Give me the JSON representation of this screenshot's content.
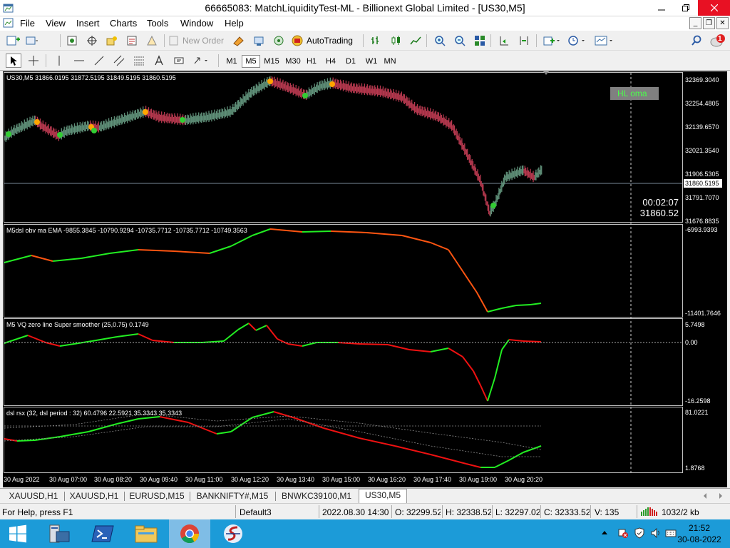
{
  "window": {
    "title": "66665083: MatchLiquidityTest-ML - Billionext Global Limited - [US30,M5]"
  },
  "menu": {
    "items": [
      "File",
      "View",
      "Insert",
      "Charts",
      "Tools",
      "Window",
      "Help"
    ]
  },
  "toolbar": {
    "new_order_label": "New Order",
    "autotrading_label": "AutoTrading",
    "alert_count": "1"
  },
  "timeframes": [
    "M1",
    "M5",
    "M15",
    "M30",
    "H1",
    "H4",
    "D1",
    "W1",
    "MN"
  ],
  "active_timeframe": "M5",
  "chart": {
    "main_header": "US30,M5  31866.0195 31872.5195 31849.5195 31860.5195",
    "hl_label": "HL oma",
    "countdown": "00:02:07",
    "bid_label": "31860.52",
    "price_box": "31860.5195",
    "price_ticks": [
      "32369.3040",
      "32254.4805",
      "32139.6570",
      "32021.3540",
      "31906.5305",
      "31791.7070",
      "31676.8835"
    ],
    "ind1_header": "M5dsl  obv ma  EMA  -9855.3845 -10790.9294 -10735.7712 -10735.7712 -10749.3563",
    "ind1_ticks": [
      "-6993.9393",
      "-11401.7646"
    ],
    "ind2_header": "M5 VQ zero line Super smoother (25,0.75) 0.1749",
    "ind2_ticks": [
      "5.7498",
      "0.00",
      "-16.2598"
    ],
    "ind3_header": "dsl rsx (32, dsl period : 32) 60.4796 22.5921 35.3343 35.3343",
    "ind3_ticks": [
      "81.0221",
      "1.8768"
    ],
    "time_ticks": [
      "30 Aug 2022",
      "30 Aug 07:00",
      "30 Aug 08:20",
      "30 Aug 09:40",
      "30 Aug 11:00",
      "30 Aug 12:20",
      "30 Aug 13:40",
      "30 Aug 15:00",
      "30 Aug 16:20",
      "30 Aug 17:40",
      "30 Aug 19:00",
      "30 Aug 20:20"
    ]
  },
  "tabs": [
    "XAUUSD,H1",
    "XAUUSD,H1",
    "EURUSD,M15",
    "BANKNIFTY#,M15",
    "BNWKC39100,M1",
    "US30,M5"
  ],
  "active_tab": "US30,M5",
  "status": {
    "help": "For Help, press F1",
    "profile": "Default3",
    "datetime": "2022.08.30 14:30",
    "open": "O: 32299.520",
    "high": "H: 32338.520",
    "low": "L: 32297.020",
    "close": "C: 32333.520",
    "volume": "V: 135",
    "traffic": "1032/2 kb"
  },
  "taskbar": {
    "time": "21:52",
    "date": "30-08-2022"
  },
  "colors": {
    "up": "#5f8f78",
    "down": "#b5384e",
    "green_line": "#22ee22",
    "orange_line": "#ff5511",
    "red_line": "#ee1111",
    "dot_orange": "#ffa500",
    "dot_green": "#33cc33"
  }
}
